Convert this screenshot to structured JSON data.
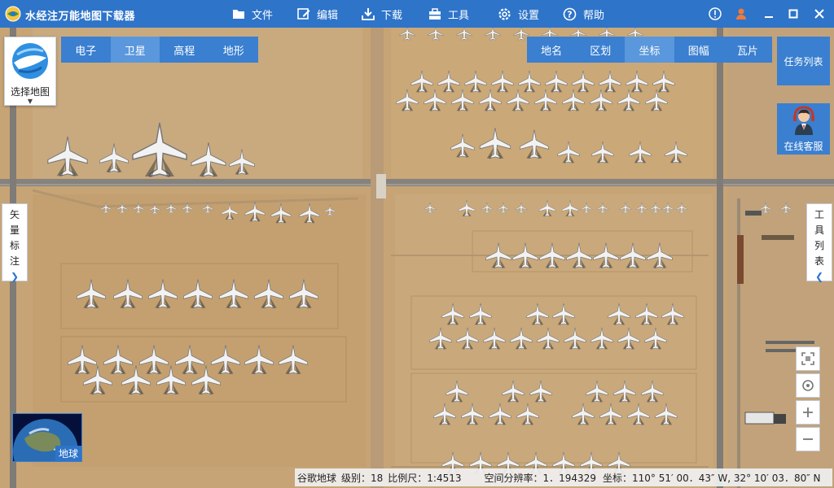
{
  "app": {
    "title": "水经注万能地图下载器"
  },
  "menu": [
    {
      "label": "文件",
      "icon": "folder-icon"
    },
    {
      "label": "编辑",
      "icon": "edit-icon"
    },
    {
      "label": "下载",
      "icon": "download-icon"
    },
    {
      "label": "工具",
      "icon": "toolbox-icon"
    },
    {
      "label": "设置",
      "icon": "gear-icon"
    },
    {
      "label": "帮助",
      "icon": "help-icon"
    }
  ],
  "window_controls": [
    "info-icon",
    "user-icon",
    "minimize-icon",
    "maximize-icon",
    "close-icon"
  ],
  "choose_map": {
    "label": "选择地图"
  },
  "map_type_tabs": [
    {
      "label": "电子",
      "active": false
    },
    {
      "label": "卫星",
      "active": true
    },
    {
      "label": "高程",
      "active": false
    },
    {
      "label": "地形",
      "active": false
    }
  ],
  "layer_tabs": [
    {
      "label": "地名",
      "active": false
    },
    {
      "label": "区划",
      "active": false
    },
    {
      "label": "坐标",
      "active": true
    },
    {
      "label": "图幅",
      "active": false
    },
    {
      "label": "瓦片",
      "active": false
    }
  ],
  "task_list": {
    "label": "任务列表"
  },
  "online_service": {
    "label": "在线客服"
  },
  "left_panel": {
    "chars": [
      "矢",
      "量",
      "标",
      "注"
    ]
  },
  "right_panel": {
    "chars": [
      "工",
      "具",
      "列",
      "表"
    ]
  },
  "earth_thumb": {
    "label": "地球"
  },
  "status": {
    "source": "谷歌地球",
    "level": "级别：18",
    "scale": "比例尺：1:4513",
    "resolution": "空间分辨率：1．194329",
    "coords": "坐标：110° 51′ 00．43″ W, 32° 10′ 03．80″ N"
  },
  "colors": {
    "accent": "#2e74c9",
    "ground": "#c9a879",
    "road": "#8a8580"
  }
}
